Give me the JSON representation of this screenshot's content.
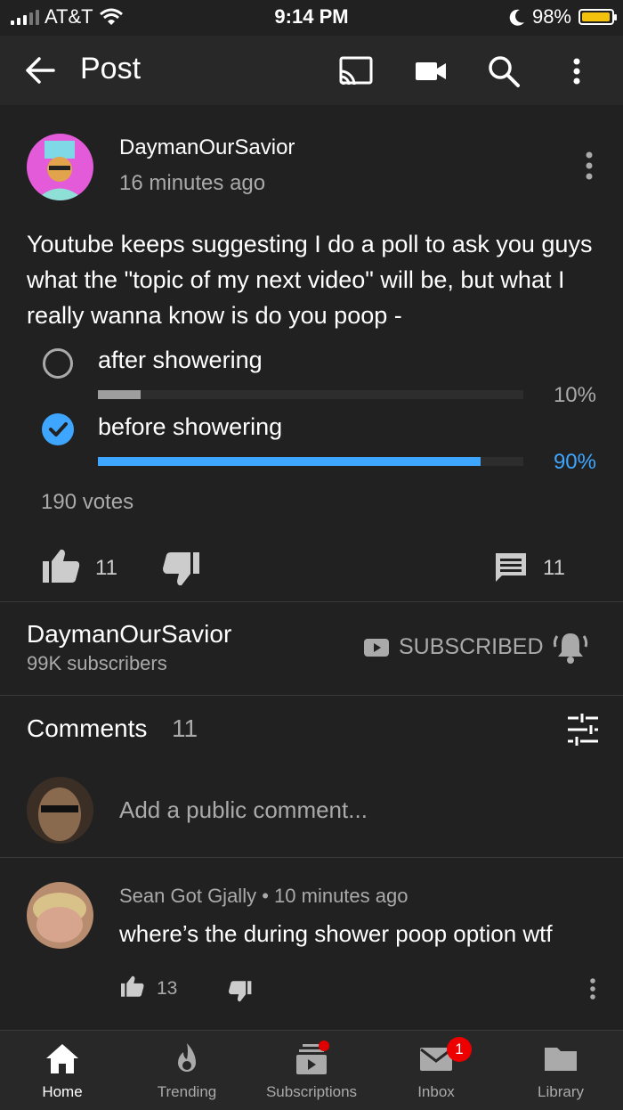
{
  "status_bar": {
    "carrier": "AT&T",
    "time": "9:14 PM",
    "battery": "98%"
  },
  "app_bar": {
    "title": "Post"
  },
  "post": {
    "author": "DaymanOurSavior",
    "time": "16 minutes ago",
    "text": "Youtube keeps suggesting I do a poll to ask you guys what the \"topic of my next video\" will be, but what I really wanna know is do you poop -",
    "poll": {
      "options": [
        {
          "label": "after showering",
          "percent": "10%",
          "fraction": 0.1,
          "selected": false
        },
        {
          "label": "before showering",
          "percent": "90%",
          "fraction": 0.9,
          "selected": true
        }
      ],
      "votes": "190 votes"
    },
    "likes": "11",
    "comments_count": "11"
  },
  "channel": {
    "name": "DaymanOurSavior",
    "subscribers": "99K subscribers",
    "subscribe_state": "SUBSCRIBED"
  },
  "comments": {
    "title": "Comments",
    "count": "11",
    "add_placeholder": "Add a public comment...",
    "items": [
      {
        "author": "Sean Got Gjally",
        "time": "10 minutes ago",
        "separator": "•",
        "text": "where’s the during shower poop option wtf",
        "likes": "13"
      }
    ]
  },
  "bottom_nav": {
    "items": [
      {
        "label": "Home",
        "icon": "home-icon"
      },
      {
        "label": "Trending",
        "icon": "flame-icon"
      },
      {
        "label": "Subscriptions",
        "icon": "subscriptions-icon"
      },
      {
        "label": "Inbox",
        "icon": "mail-icon"
      },
      {
        "label": "Library",
        "icon": "folder-icon"
      }
    ],
    "inbox_badge": "1"
  },
  "colors": {
    "accent": "#3ea6ff",
    "background": "#212121",
    "appbar": "#282828",
    "battery": "#f4c20d",
    "badge": "#e00000"
  }
}
